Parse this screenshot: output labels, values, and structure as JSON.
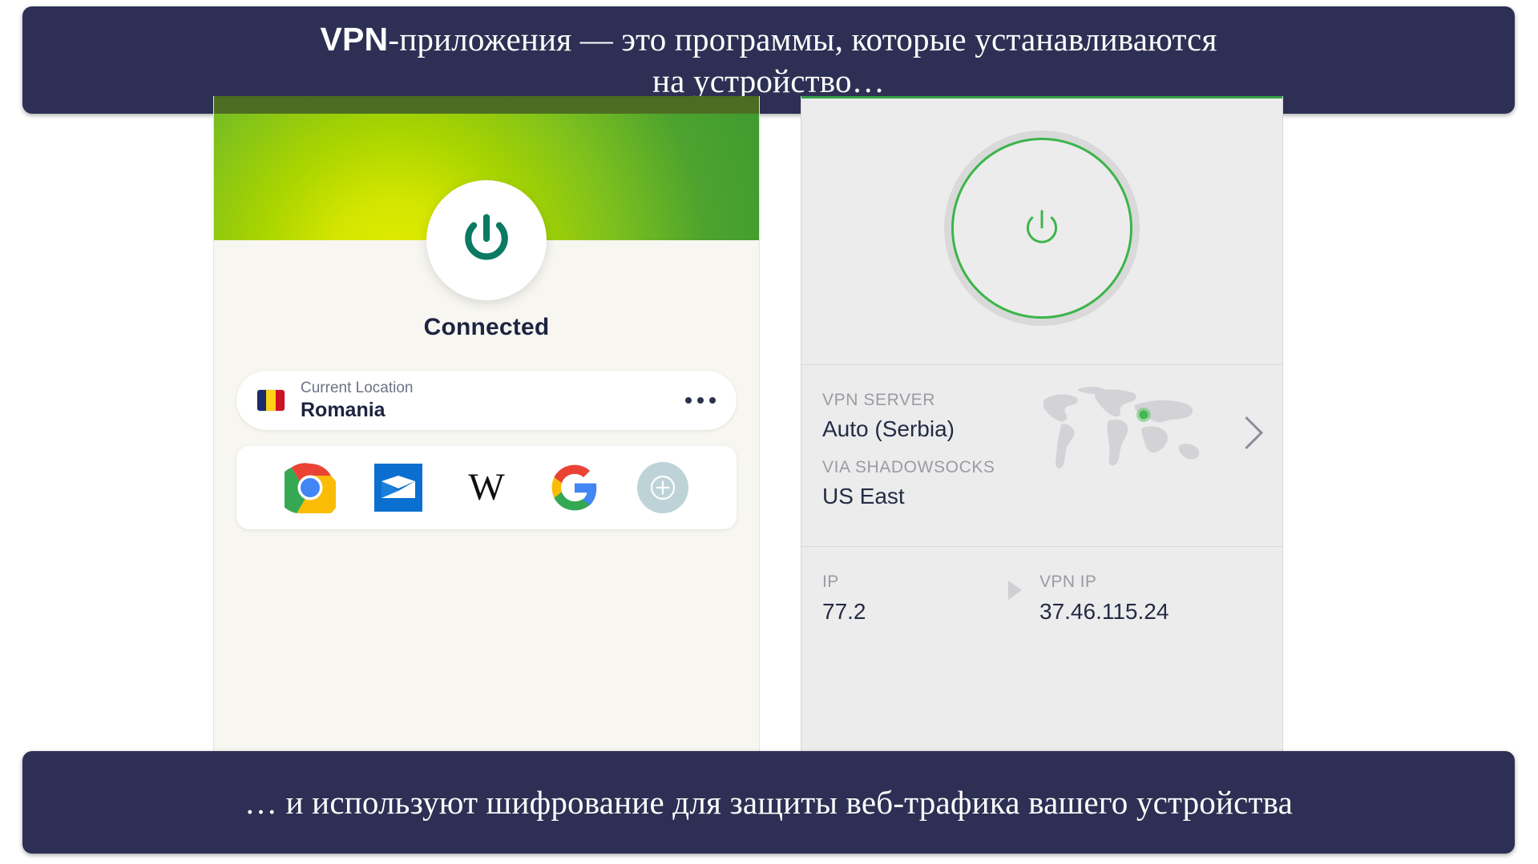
{
  "banners": {
    "top_prefix": "VPN",
    "top_text": "-приложения — это программы, которые устанавливаются",
    "top_text_line2": "на устройство…",
    "bottom_text": "… и используют шифрование для защиты веб-трафика вашего устройства",
    "background_color": "#2d3054",
    "text_color": "#ffffff"
  },
  "left_app": {
    "status": "Connected",
    "power_icon_color": "#0c7a63",
    "hero_gradient_from": "#e3eb00",
    "hero_gradient_to": "#3f9a2f",
    "location_card": {
      "label": "Current Location",
      "value": "Romania",
      "flag": "romania-flag-icon",
      "menu_icon": "ellipsis-icon"
    },
    "shortcuts": [
      {
        "name": "chrome-icon",
        "label": "Chrome"
      },
      {
        "name": "mail-icon",
        "label": "Mail"
      },
      {
        "name": "wikipedia-icon",
        "label": "W"
      },
      {
        "name": "google-icon",
        "label": "Google"
      },
      {
        "name": "add-shortcut-icon",
        "label": "+"
      }
    ]
  },
  "right_app": {
    "power_icon_color": "#3bb54a",
    "accent_color": "#35a145",
    "server": {
      "key": "VPN SERVER",
      "value": "Auto (Serbia)",
      "via_key": "VIA SHADOWSOCKS",
      "via_value": "US East",
      "map_icon": "world-map-icon",
      "chevron_icon": "chevron-right-icon"
    },
    "ip": {
      "key": "IP",
      "value": "77.2",
      "vpn_key": "VPN IP",
      "vpn_value": "37.46.115.24",
      "arrow_icon": "triangle-right-icon"
    }
  }
}
